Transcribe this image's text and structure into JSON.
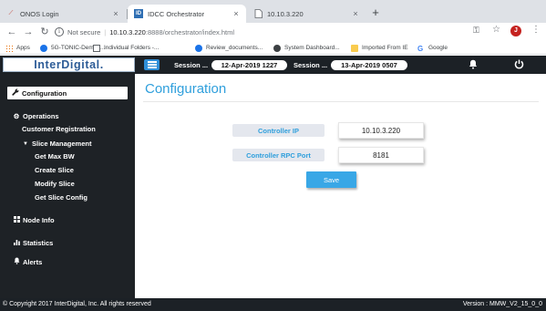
{
  "browser": {
    "tabs": [
      {
        "title": "ONOS Login",
        "close": "×"
      },
      {
        "title": "IDCC Orchestrator",
        "close": "×"
      },
      {
        "title": "10.10.3.220",
        "close": "×"
      }
    ],
    "new_tab": "+",
    "address": {
      "info": "i",
      "not_secure": "Not secure",
      "pipe": "|",
      "host": "10.10.3.220",
      "path": ":8888/orchestrator/index.html"
    },
    "profile_initial": "J",
    "bookmarks": [
      "Apps",
      "5G-TONIC-Demo4...",
      "Individual Folders -...",
      "Review_documents...",
      "System Dashboard...",
      "Imported From IE",
      "Google"
    ]
  },
  "header": {
    "logo": "InterDigital.",
    "session_label_1": "Session ...",
    "session_value_1": "12-Apr-2019 1227",
    "session_label_2": "Session ...",
    "session_value_2": "13-Apr-2019 0507"
  },
  "sidebar": {
    "configuration": "Configuration",
    "operations": "Operations",
    "customer_registration": "Customer Registration",
    "slice_management": "Slice Management",
    "get_max_bw": "Get Max BW",
    "create_slice": "Create Slice",
    "modify_slice": "Modify Slice",
    "get_slice_config": "Get Slice Config",
    "node_info": "Node Info",
    "statistics": "Statistics",
    "alerts": "Alerts"
  },
  "main": {
    "title": "Configuration",
    "controller_ip_label": "Controller IP",
    "controller_ip_value": "10.10.3.220",
    "controller_port_label": "Controller RPC Port",
    "controller_port_value": "8181",
    "save_label": "Save"
  },
  "footer": {
    "copyright": "© Copyright 2017 InterDigital, Inc. All rights reserved",
    "version": "Version : MMW_V2_15_0_0"
  },
  "colors": {
    "accent": "#2f9fdc",
    "header_bg": "#1c2126",
    "sidebar_bg": "#1e2226",
    "save_button": "#39a7e6",
    "logo_text": "#2d5c97"
  },
  "icons": [
    "onos-favicon",
    "interdigital-favicon",
    "page-favicon",
    "back-icon",
    "forward-icon",
    "reload-icon",
    "info-icon",
    "key-icon",
    "star-icon",
    "menu-icon",
    "apps-icon",
    "bell-icon",
    "power-icon",
    "wrench-icon",
    "gear-icon",
    "caret-down-icon",
    "grid-icon",
    "bar-chart-icon"
  ]
}
